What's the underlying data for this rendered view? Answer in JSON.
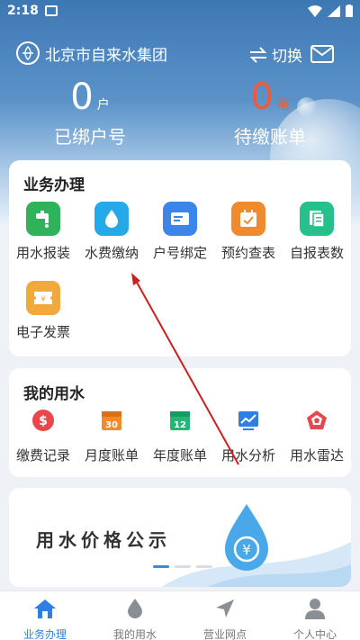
{
  "status_bar": {
    "time": "2:18"
  },
  "header": {
    "company": "北京市自来水集团",
    "switch_label": "切换",
    "stats": [
      {
        "value": "0",
        "unit": "户",
        "label": "已绑户号"
      },
      {
        "value": "0",
        "unit": "笔",
        "label": "待缴账单"
      }
    ]
  },
  "business": {
    "title": "业务办理",
    "items": [
      {
        "label": "用水报装",
        "icon": "faucet-icon"
      },
      {
        "label": "水费缴纳",
        "icon": "water-drop-icon"
      },
      {
        "label": "户号绑定",
        "icon": "account-card-icon"
      },
      {
        "label": "预约查表",
        "icon": "calendar-check-icon"
      },
      {
        "label": "自报表数",
        "icon": "documents-icon"
      },
      {
        "label": "电子发票",
        "icon": "invoice-ticket-icon"
      }
    ]
  },
  "my_water": {
    "title": "我的用水",
    "items": [
      {
        "label": "缴费记录",
        "icon": "dollar-circle-icon"
      },
      {
        "label": "月度账单",
        "icon": "calendar-30-icon",
        "badge": "30"
      },
      {
        "label": "年度账单",
        "icon": "calendar-12-icon",
        "badge": "12"
      },
      {
        "label": "用水分析",
        "icon": "line-chart-icon"
      },
      {
        "label": "用水雷达",
        "icon": "radar-icon"
      }
    ]
  },
  "banner": {
    "title": "用水价格公示",
    "coin_symbol": "¥"
  },
  "tab_bar": {
    "tabs": [
      {
        "label": "业务办理",
        "icon": "home-icon",
        "active": true
      },
      {
        "label": "我的用水",
        "icon": "water-drop-icon"
      },
      {
        "label": "营业网点",
        "icon": "location-arrow-icon"
      },
      {
        "label": "个人中心",
        "icon": "person-icon"
      }
    ]
  },
  "colors": {
    "accent": "#2d7fe6",
    "header_blue": "#3e78b4",
    "alert_red": "#f05a3a"
  }
}
